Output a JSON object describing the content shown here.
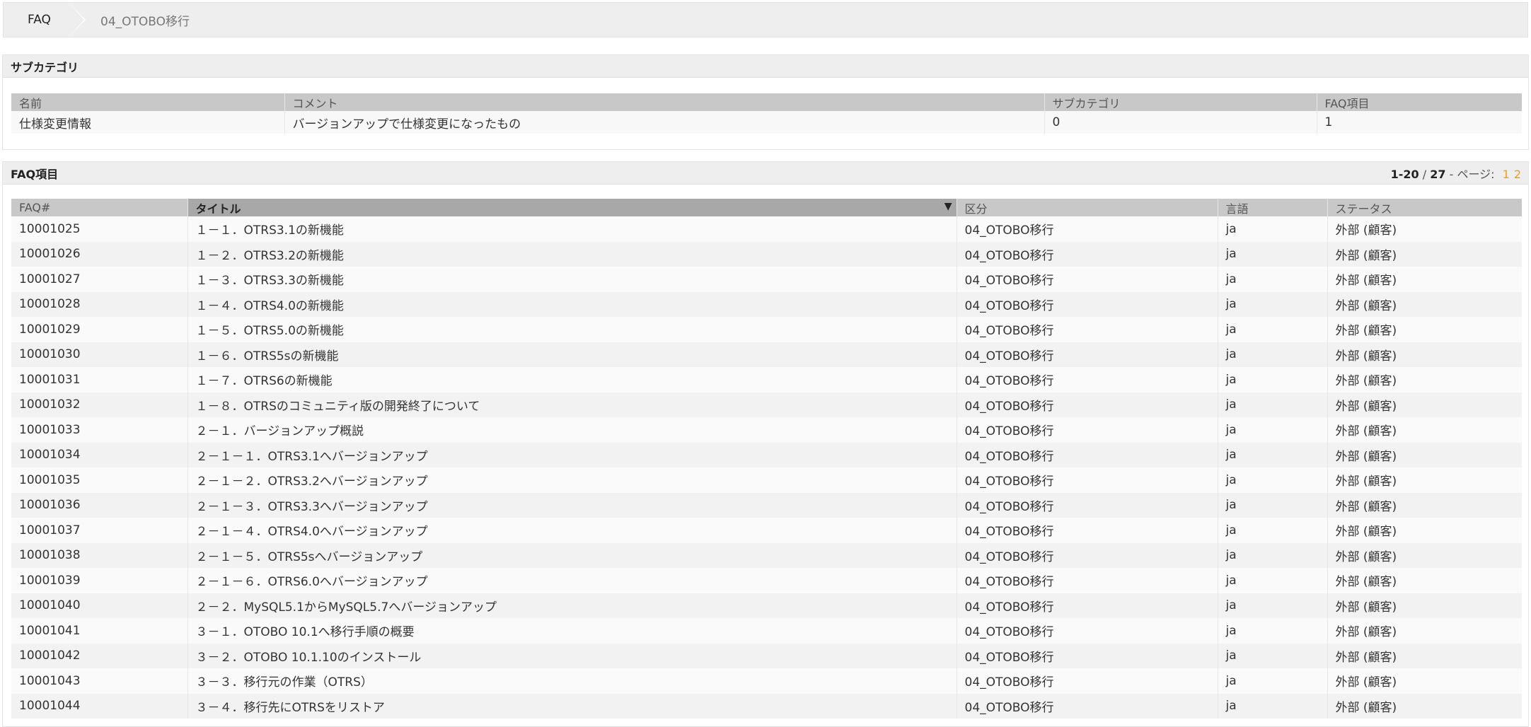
{
  "breadcrumb": {
    "items": [
      "FAQ",
      "04_OTOBO移行"
    ]
  },
  "subcategory": {
    "title": "サブカテゴリ",
    "columns": [
      "名前",
      "コメント",
      "サブカテゴリ",
      "FAQ項目"
    ],
    "rows": [
      [
        "仕様変更情報",
        "バージョンアップで仕様変更になったもの",
        "0",
        "1"
      ]
    ]
  },
  "faq": {
    "title": "FAQ項目",
    "pager": {
      "range": "1-20",
      "separator": " / ",
      "total": "27",
      "label": " - ページ: ",
      "pages": [
        "1",
        "2"
      ]
    },
    "columns": [
      "FAQ#",
      "タイトル",
      "区分",
      "言語",
      "ステータス"
    ],
    "sort_indicator": "▼",
    "rows": [
      [
        "10001025",
        "１－１．OTRS3.1の新機能",
        "04_OTOBO移行",
        "ja",
        "外部 (顧客)"
      ],
      [
        "10001026",
        "１－２．OTRS3.2の新機能",
        "04_OTOBO移行",
        "ja",
        "外部 (顧客)"
      ],
      [
        "10001027",
        "１－３．OTRS3.3の新機能",
        "04_OTOBO移行",
        "ja",
        "外部 (顧客)"
      ],
      [
        "10001028",
        "１－４．OTRS4.0の新機能",
        "04_OTOBO移行",
        "ja",
        "外部 (顧客)"
      ],
      [
        "10001029",
        "１－５．OTRS5.0の新機能",
        "04_OTOBO移行",
        "ja",
        "外部 (顧客)"
      ],
      [
        "10001030",
        "１－６．OTRS5sの新機能",
        "04_OTOBO移行",
        "ja",
        "外部 (顧客)"
      ],
      [
        "10001031",
        "１－７．OTRS6の新機能",
        "04_OTOBO移行",
        "ja",
        "外部 (顧客)"
      ],
      [
        "10001032",
        "１－８．OTRSのコミュニティ版の開発終了について",
        "04_OTOBO移行",
        "ja",
        "外部 (顧客)"
      ],
      [
        "10001033",
        "２－１．バージョンアップ概説",
        "04_OTOBO移行",
        "ja",
        "外部 (顧客)"
      ],
      [
        "10001034",
        "２－１－１．OTRS3.1へバージョンアップ",
        "04_OTOBO移行",
        "ja",
        "外部 (顧客)"
      ],
      [
        "10001035",
        "２－１－２．OTRS3.2へバージョンアップ",
        "04_OTOBO移行",
        "ja",
        "外部 (顧客)"
      ],
      [
        "10001036",
        "２－１－３．OTRS3.3へバージョンアップ",
        "04_OTOBO移行",
        "ja",
        "外部 (顧客)"
      ],
      [
        "10001037",
        "２－１－４．OTRS4.0へバージョンアップ",
        "04_OTOBO移行",
        "ja",
        "外部 (顧客)"
      ],
      [
        "10001038",
        "２－１－５．OTRS5sへバージョンアップ",
        "04_OTOBO移行",
        "ja",
        "外部 (顧客)"
      ],
      [
        "10001039",
        "２－１－６．OTRS6.0へバージョンアップ",
        "04_OTOBO移行",
        "ja",
        "外部 (顧客)"
      ],
      [
        "10001040",
        "２－２．MySQL5.1からMySQL5.7へバージョンアップ",
        "04_OTOBO移行",
        "ja",
        "外部 (顧客)"
      ],
      [
        "10001041",
        "３－１．OTOBO 10.1へ移行手順の概要",
        "04_OTOBO移行",
        "ja",
        "外部 (顧客)"
      ],
      [
        "10001042",
        "３－２．OTOBO 10.1.10のインストール",
        "04_OTOBO移行",
        "ja",
        "外部 (顧客)"
      ],
      [
        "10001043",
        "３－３．移行元の作業（OTRS）",
        "04_OTOBO移行",
        "ja",
        "外部 (顧客)"
      ],
      [
        "10001044",
        "３－４．移行先にOTRSをリストア",
        "04_OTOBO移行",
        "ja",
        "外部 (顧客)"
      ]
    ]
  }
}
